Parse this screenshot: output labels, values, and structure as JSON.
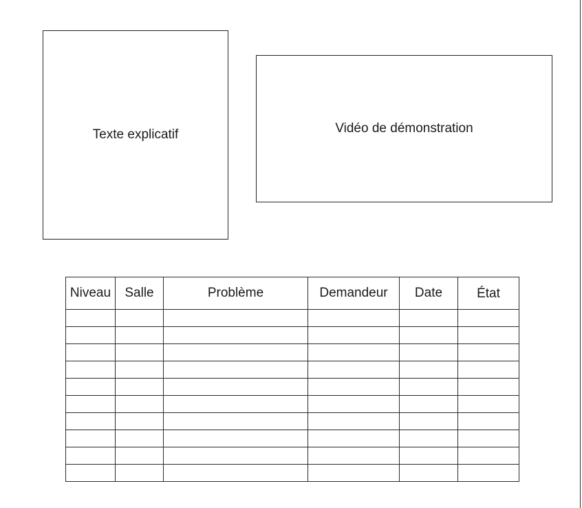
{
  "boxes": {
    "text": "Texte explicatif",
    "video": "Vidéo de démonstration"
  },
  "table": {
    "headers": [
      "Niveau",
      "Salle",
      "Problème",
      "Demandeur",
      "Date",
      "État"
    ],
    "rows": [
      [
        "",
        "",
        "",
        "",
        "",
        ""
      ],
      [
        "",
        "",
        "",
        "",
        "",
        ""
      ],
      [
        "",
        "",
        "",
        "",
        "",
        ""
      ],
      [
        "",
        "",
        "",
        "",
        "",
        ""
      ],
      [
        "",
        "",
        "",
        "",
        "",
        ""
      ],
      [
        "",
        "",
        "",
        "",
        "",
        ""
      ],
      [
        "",
        "",
        "",
        "",
        "",
        ""
      ],
      [
        "",
        "",
        "",
        "",
        "",
        ""
      ],
      [
        "",
        "",
        "",
        "",
        "",
        ""
      ],
      [
        "",
        "",
        "",
        "",
        "",
        ""
      ]
    ]
  }
}
